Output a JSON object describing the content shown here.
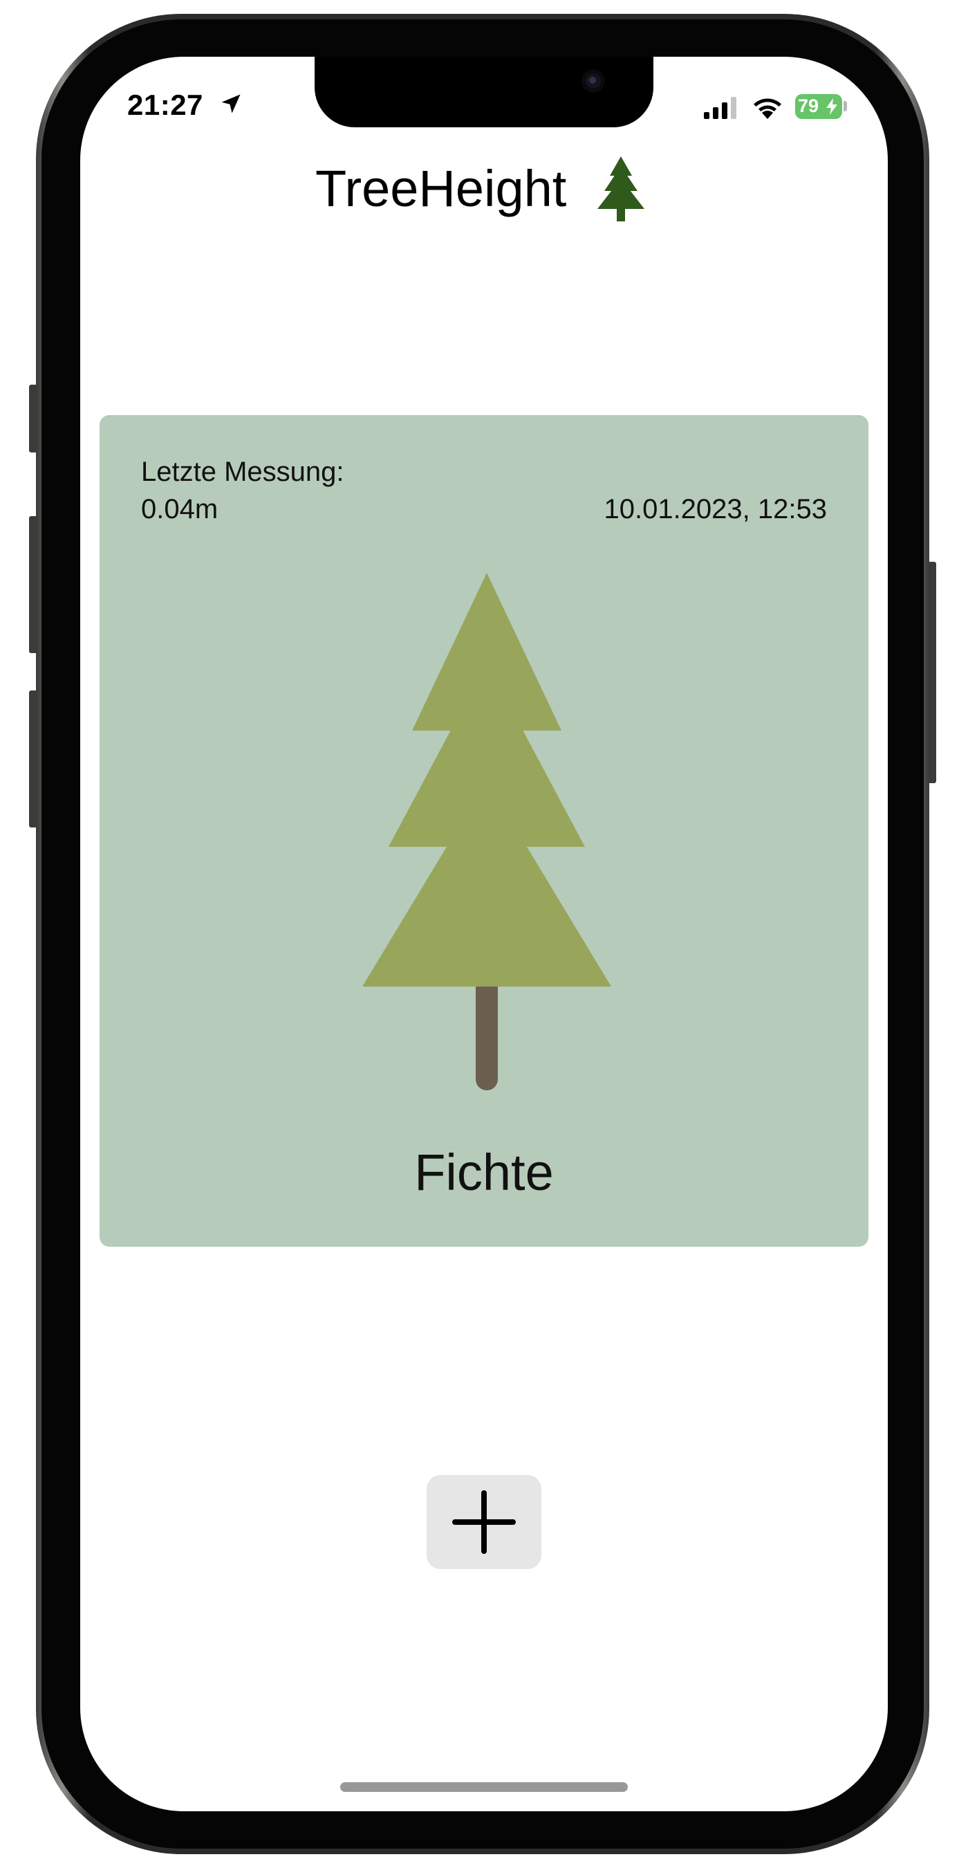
{
  "status_bar": {
    "time": "21:27",
    "battery_level": "79",
    "icons": [
      "location-arrow-icon",
      "cellular-signal-icon",
      "wifi-icon",
      "battery-charging-icon"
    ]
  },
  "header": {
    "title": "TreeHeight",
    "icon": "evergreen-tree-icon"
  },
  "measurement_card": {
    "label": "Letzte Messung:",
    "value": "0.04m",
    "timestamp": "10.01.2023, 12:53",
    "species": "Fichte",
    "illustration": "spruce-tree-icon"
  },
  "add_button": {
    "icon": "plus-icon"
  },
  "colors": {
    "card_background": "#b6cbba",
    "tree_foliage": "#97a65b",
    "tree_trunk": "#6b5f4f",
    "title_icon_green": "#2f5a1c",
    "battery_green": "#67c469",
    "add_button_background": "#e6e6e6"
  }
}
